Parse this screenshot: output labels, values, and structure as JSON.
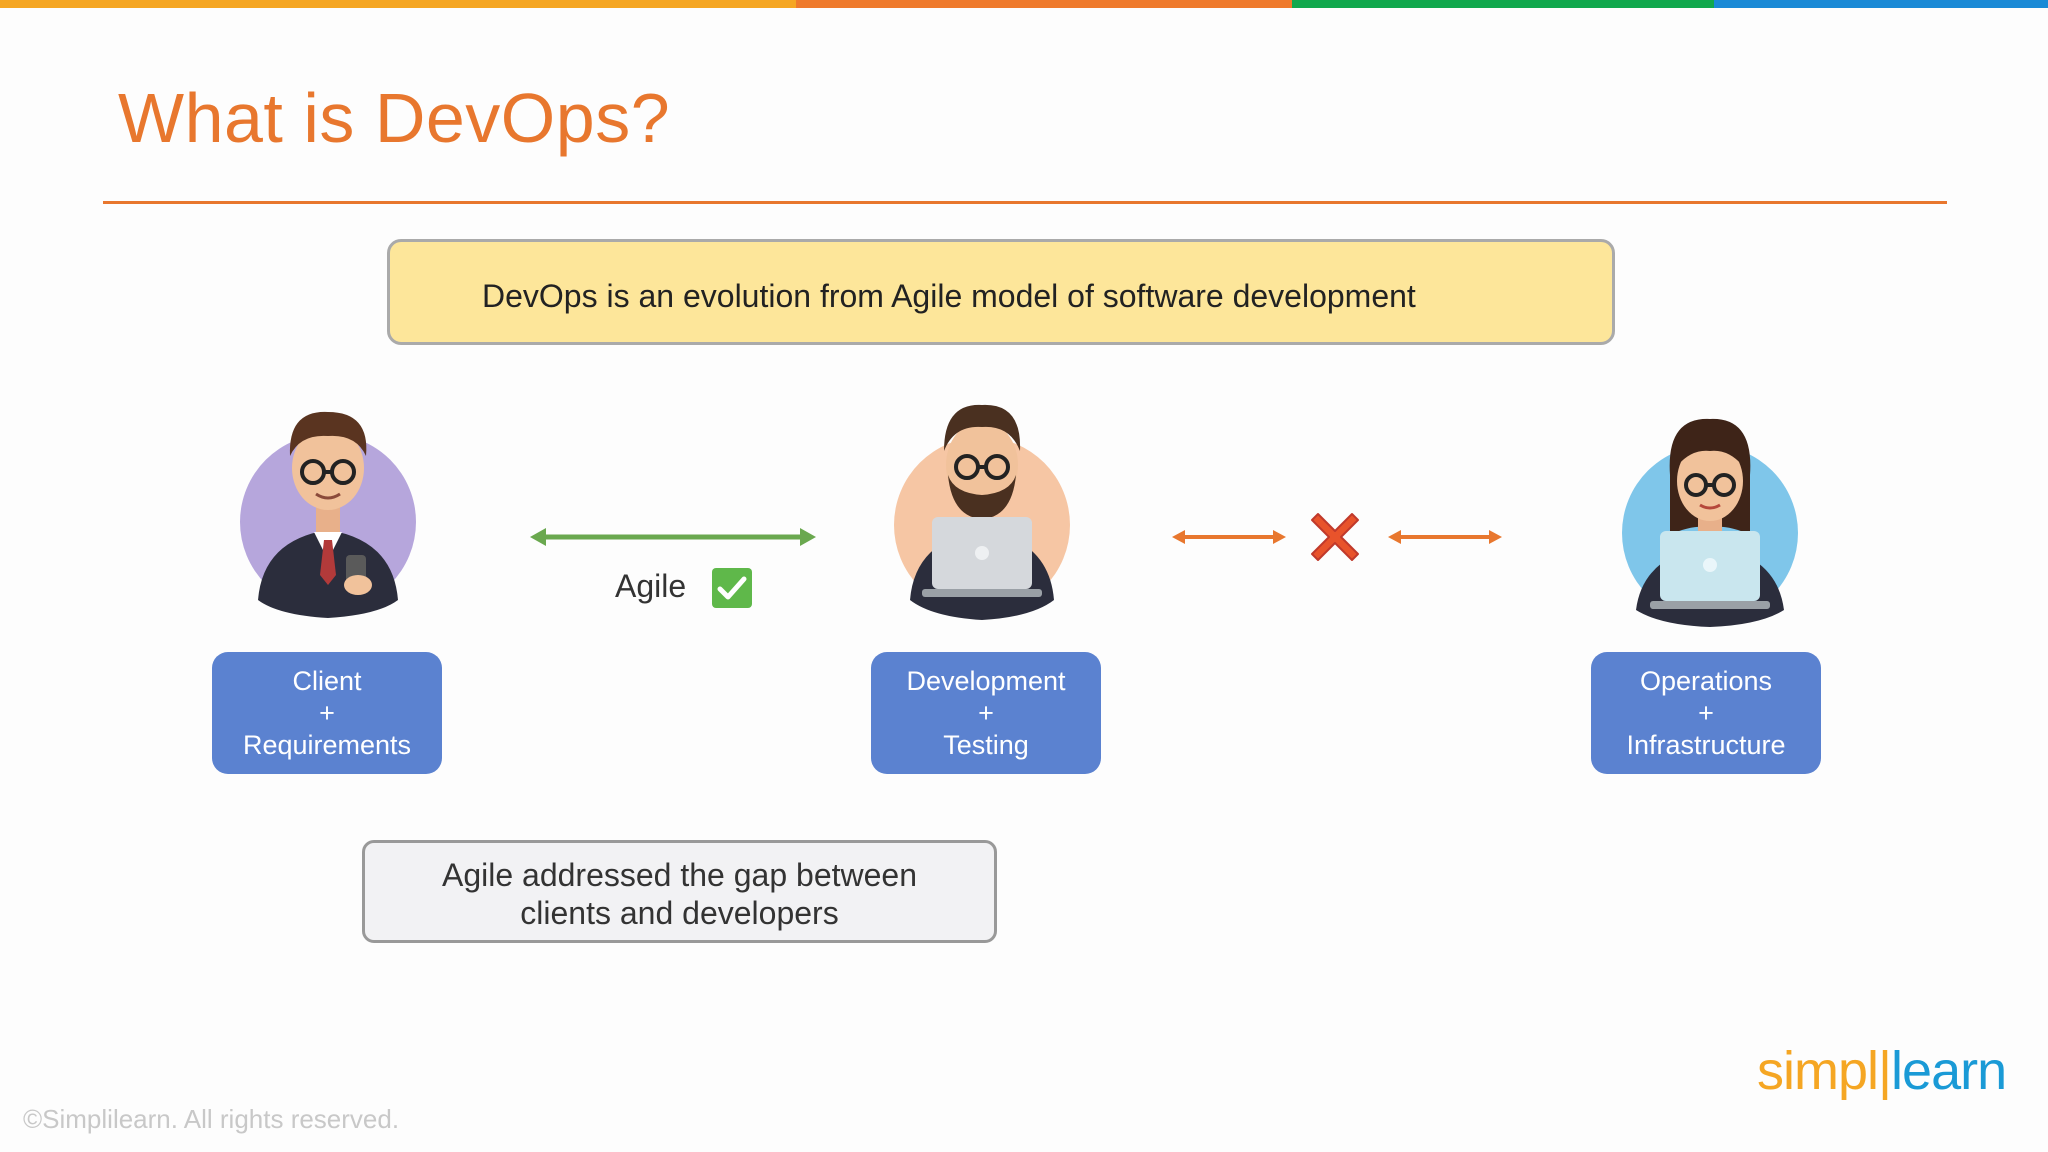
{
  "slide": {
    "title": "What is DevOps?",
    "banner": "DevOps is an evolution from Agile model of software development",
    "agile_label": "Agile",
    "note_line1": "Agile addressed the gap between",
    "note_line2": "clients and developers",
    "footer": "©Simplilearn. All rights reserved.",
    "logo_part1": "simpl",
    "logo_part2": "learn"
  },
  "roles": [
    {
      "line1": "Client",
      "line2": "+",
      "line3": "Requirements"
    },
    {
      "line1": "Development",
      "line2": "+",
      "line3": "Testing"
    },
    {
      "line1": "Operations",
      "line2": "+",
      "line3": "Infrastructure"
    }
  ],
  "colors": {
    "accent": "#e8772e",
    "role_box": "#5b82d0",
    "banner_fill": "#fde69a",
    "agile_arrow": "#6aa84f",
    "check_box": "#5fb84a",
    "cross": "#e8532b",
    "topbar": [
      "#f5a623",
      "#ef7a2c",
      "#11a84d",
      "#1a8ad6"
    ]
  },
  "icons": {
    "connection_ok": "check-icon",
    "connection_broken": "cross-icon"
  }
}
